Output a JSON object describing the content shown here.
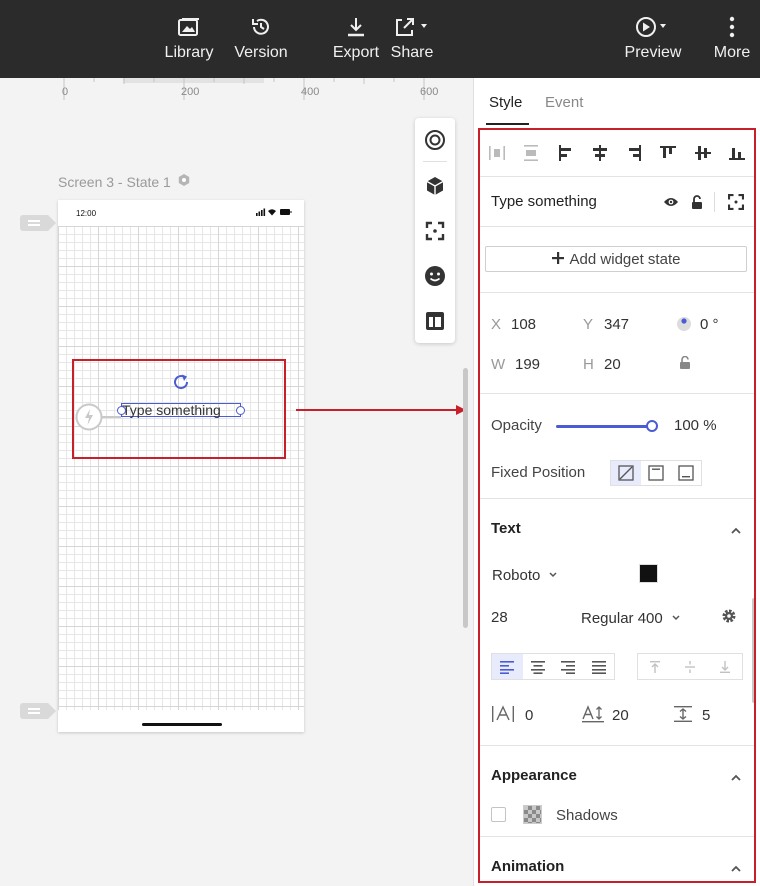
{
  "toolbar": {
    "library_label": "Library",
    "version_label": "Version",
    "export_label": "Export",
    "share_label": "Share",
    "preview_label": "Preview",
    "more_label": "More"
  },
  "ruler": {
    "ticks": [
      "0",
      "200",
      "400",
      "600"
    ]
  },
  "canvas": {
    "screen_label": "Screen 3 - State 1",
    "phone_time": "12:00",
    "widget_text": "Type something"
  },
  "panel": {
    "tabs": {
      "style": "Style",
      "event": "Event"
    },
    "widget_name": "Type something",
    "add_state_label": "Add widget state",
    "geometry": {
      "x_label": "X",
      "x_value": "108",
      "y_label": "Y",
      "y_value": "347",
      "rotation_value": "0 °",
      "w_label": "W",
      "w_value": "199",
      "h_label": "H",
      "h_value": "20"
    },
    "opacity": {
      "label": "Opacity",
      "value_text": "100 %",
      "value": 1.0
    },
    "fixed_position_label": "Fixed Position",
    "text": {
      "title": "Text",
      "font_family": "Roboto",
      "color": "#111111",
      "font_size": "28",
      "font_weight": "Regular 400",
      "letter_spacing": "0",
      "line_height": "20",
      "paragraph_spacing": "5"
    },
    "appearance": {
      "title": "Appearance",
      "shadows_label": "Shadows"
    },
    "animation": {
      "title": "Animation"
    }
  },
  "colors": {
    "accent": "#4a5bd4",
    "highlight_red": "#c8202b",
    "toolbar_bg": "#2b2b2b"
  }
}
